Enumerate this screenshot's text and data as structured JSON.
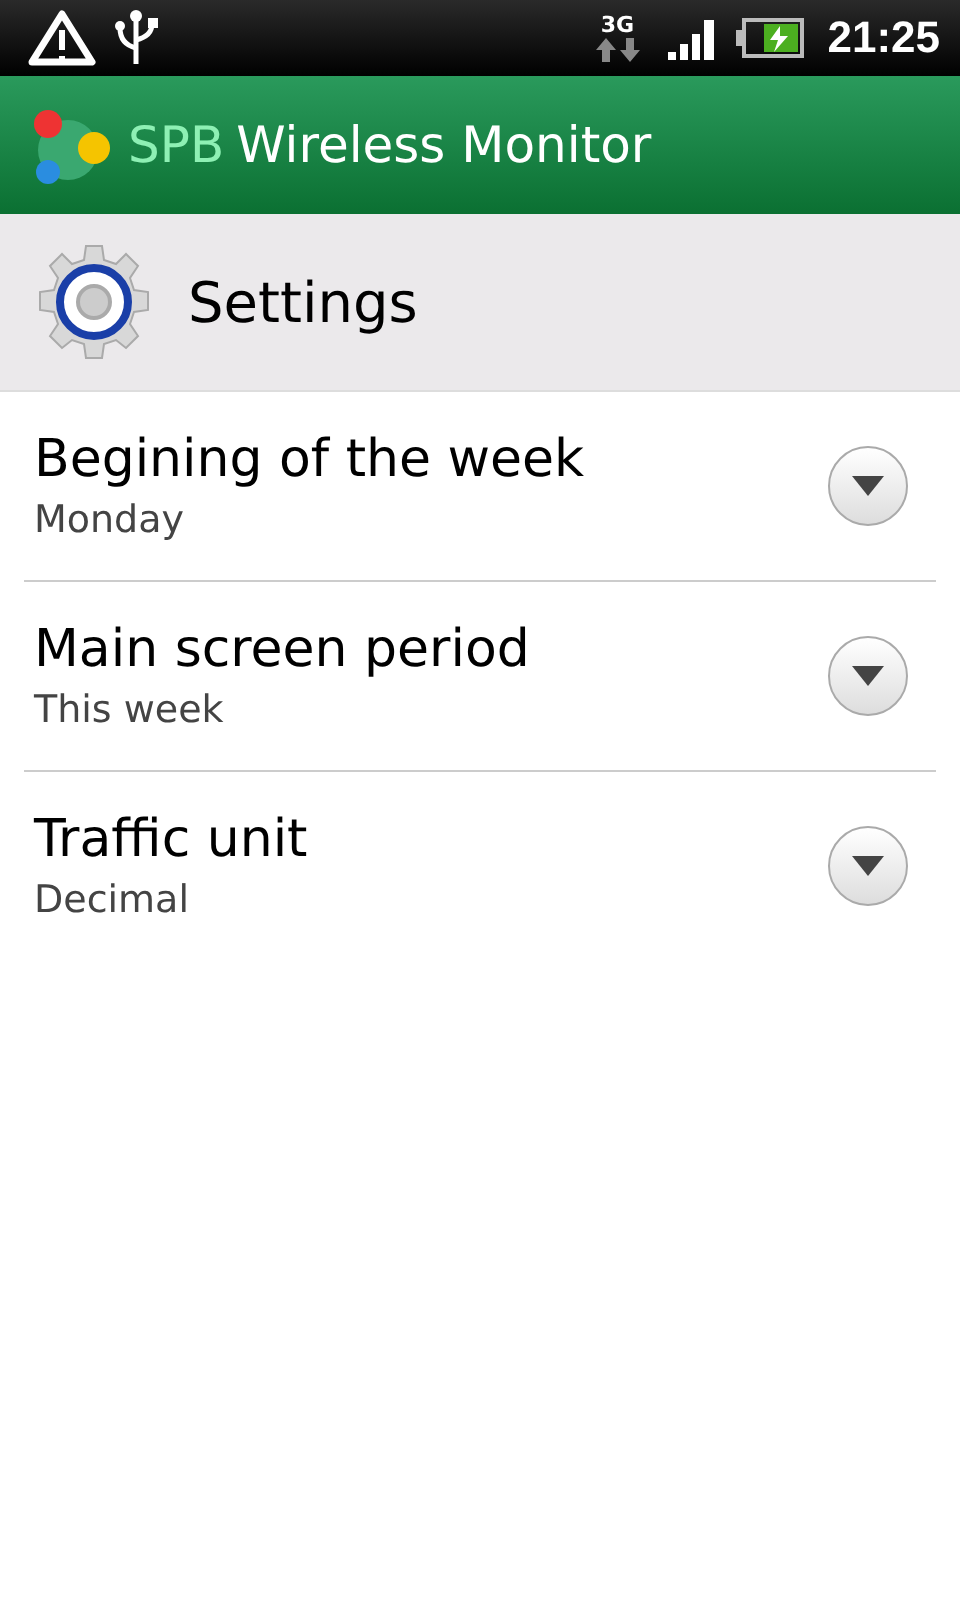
{
  "status_bar": {
    "network": "3G",
    "time": "21:25"
  },
  "app_bar": {
    "brand": "SPB",
    "name": "Wireless Monitor"
  },
  "header": {
    "title": "Settings"
  },
  "settings": [
    {
      "label": "Begining of the week",
      "value": "Monday"
    },
    {
      "label": "Main screen period",
      "value": "This week"
    },
    {
      "label": "Traffic unit",
      "value": "Decimal"
    }
  ]
}
